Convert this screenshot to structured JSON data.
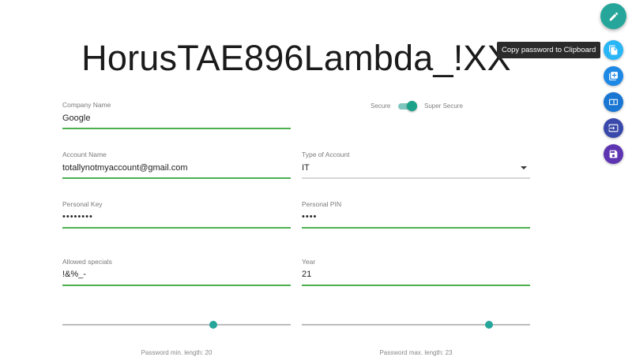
{
  "password": "HorusTAE896Lambda_!XX",
  "secure_toggle": {
    "off_label": "Secure",
    "on_label": "Super Secure",
    "state": "on"
  },
  "fields": {
    "company_name": {
      "label": "Company Name",
      "value": "Google"
    },
    "account_name": {
      "label": "Account Name",
      "value": "totallynotmyaccount@gmail.com"
    },
    "account_type": {
      "label": "Type of Account",
      "value": "IT"
    },
    "personal_key": {
      "label": "Personal Key",
      "value": "••••••••"
    },
    "personal_pin": {
      "label": "Personal PIN",
      "value": "••••"
    },
    "allowed_specials": {
      "label": "Allowed specials",
      "value": "!&%_-"
    },
    "year": {
      "label": "Year",
      "value": "21"
    }
  },
  "sliders": {
    "min_length": {
      "caption": "Password min. length: 20",
      "fraction": 0.66
    },
    "max_length": {
      "caption": "Password max. length: 23",
      "fraction": 0.82
    }
  },
  "actions": {
    "tooltip": "Copy password to Clipboard",
    "main_icon": "pencil-icon",
    "buttons": [
      {
        "icon": "copy-icon",
        "color": "#29b6f6"
      },
      {
        "icon": "add-box-icon",
        "color": "#1e88e5"
      },
      {
        "icon": "wallet-icon",
        "color": "#1976d2"
      },
      {
        "icon": "input-icon",
        "color": "#3949ab"
      },
      {
        "icon": "save-icon",
        "color": "#5e35b1"
      }
    ]
  },
  "colors": {
    "accent": "#26a69a",
    "underline_active": "#4caf50"
  }
}
